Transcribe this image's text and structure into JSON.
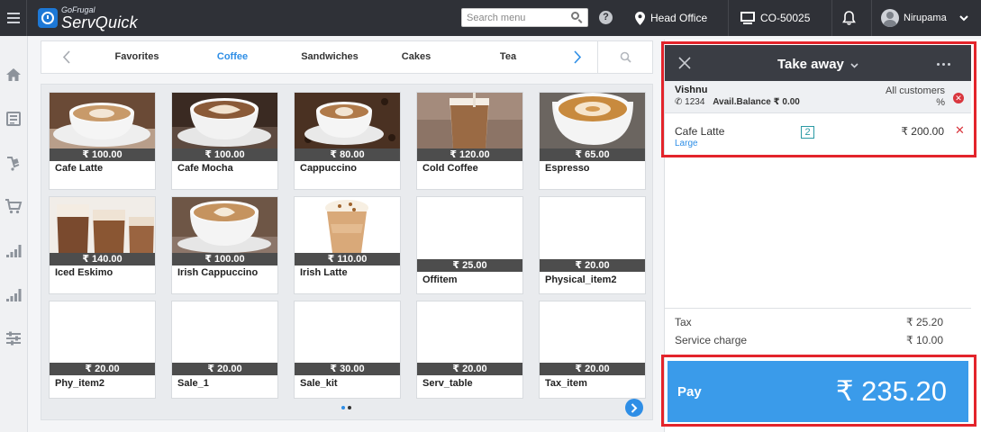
{
  "topbar": {
    "brand_small": "GoFrugal",
    "brand_name": "ServQuick",
    "search_placeholder": "Search menu",
    "location": "Head Office",
    "counter": "CO-50025",
    "user": "Nirupama"
  },
  "sidebar": {
    "icons": [
      "home-icon",
      "orders-icon",
      "checkout-icon",
      "cart-icon",
      "reports-icon",
      "analytics-icon",
      "settings-sliders-icon"
    ]
  },
  "categories": {
    "tabs": [
      "Favorites",
      "Coffee",
      "Sandwiches",
      "Cakes",
      "Tea"
    ],
    "active": "Coffee"
  },
  "products": [
    {
      "name": "Cafe Latte",
      "price": "₹ 100.00",
      "image": "cafe-latte"
    },
    {
      "name": "Cafe Mocha",
      "price": "₹ 100.00",
      "image": "cafe-mocha"
    },
    {
      "name": "Cappuccino",
      "price": "₹ 80.00",
      "image": "cappuccino"
    },
    {
      "name": "Cold Coffee",
      "price": "₹ 120.00",
      "image": "cold-coffee"
    },
    {
      "name": "Espresso",
      "price": "₹ 65.00",
      "image": "espresso"
    },
    {
      "name": "Iced Eskimo",
      "price": "₹ 140.00",
      "image": "iced-eskimo"
    },
    {
      "name": "Irish Cappuccino",
      "price": "₹ 100.00",
      "image": "irish-cappuccino"
    },
    {
      "name": "Irish Latte",
      "price": "₹ 110.00",
      "image": "irish-latte"
    },
    {
      "name": "Offitem",
      "price": "₹ 25.00",
      "image": ""
    },
    {
      "name": "Physical_item2",
      "price": "₹ 20.00",
      "image": ""
    },
    {
      "name": "Phy_item2",
      "price": "₹ 20.00",
      "image": ""
    },
    {
      "name": "Sale_1",
      "price": "₹ 20.00",
      "image": ""
    },
    {
      "name": "Sale_kit",
      "price": "₹ 30.00",
      "image": ""
    },
    {
      "name": "Serv_table",
      "price": "₹ 20.00",
      "image": ""
    },
    {
      "name": "Tax_item",
      "price": "₹ 20.00",
      "image": ""
    }
  ],
  "cart": {
    "order_type": "Take away",
    "customer": {
      "name": "Vishnu",
      "phone": "1234",
      "balance": "Avail.Balance ₹ 0.00",
      "group_line1": "All customers",
      "group_line2": "%"
    },
    "items": [
      {
        "name": "Cafe Latte",
        "variant": "Large",
        "qty": "2",
        "amount": "₹ 200.00"
      }
    ],
    "tax_label": "Tax",
    "tax_value": "₹ 25.20",
    "service_label": "Service charge",
    "service_value": "₹ 10.00",
    "pay_label": "Pay",
    "pay_amount": "₹ 235.20"
  },
  "colors": {
    "topbar": "#2f3137",
    "accent": "#2e8ee6",
    "pay": "#3a9bea",
    "highlight": "#e3242b",
    "danger": "#d9363e"
  }
}
